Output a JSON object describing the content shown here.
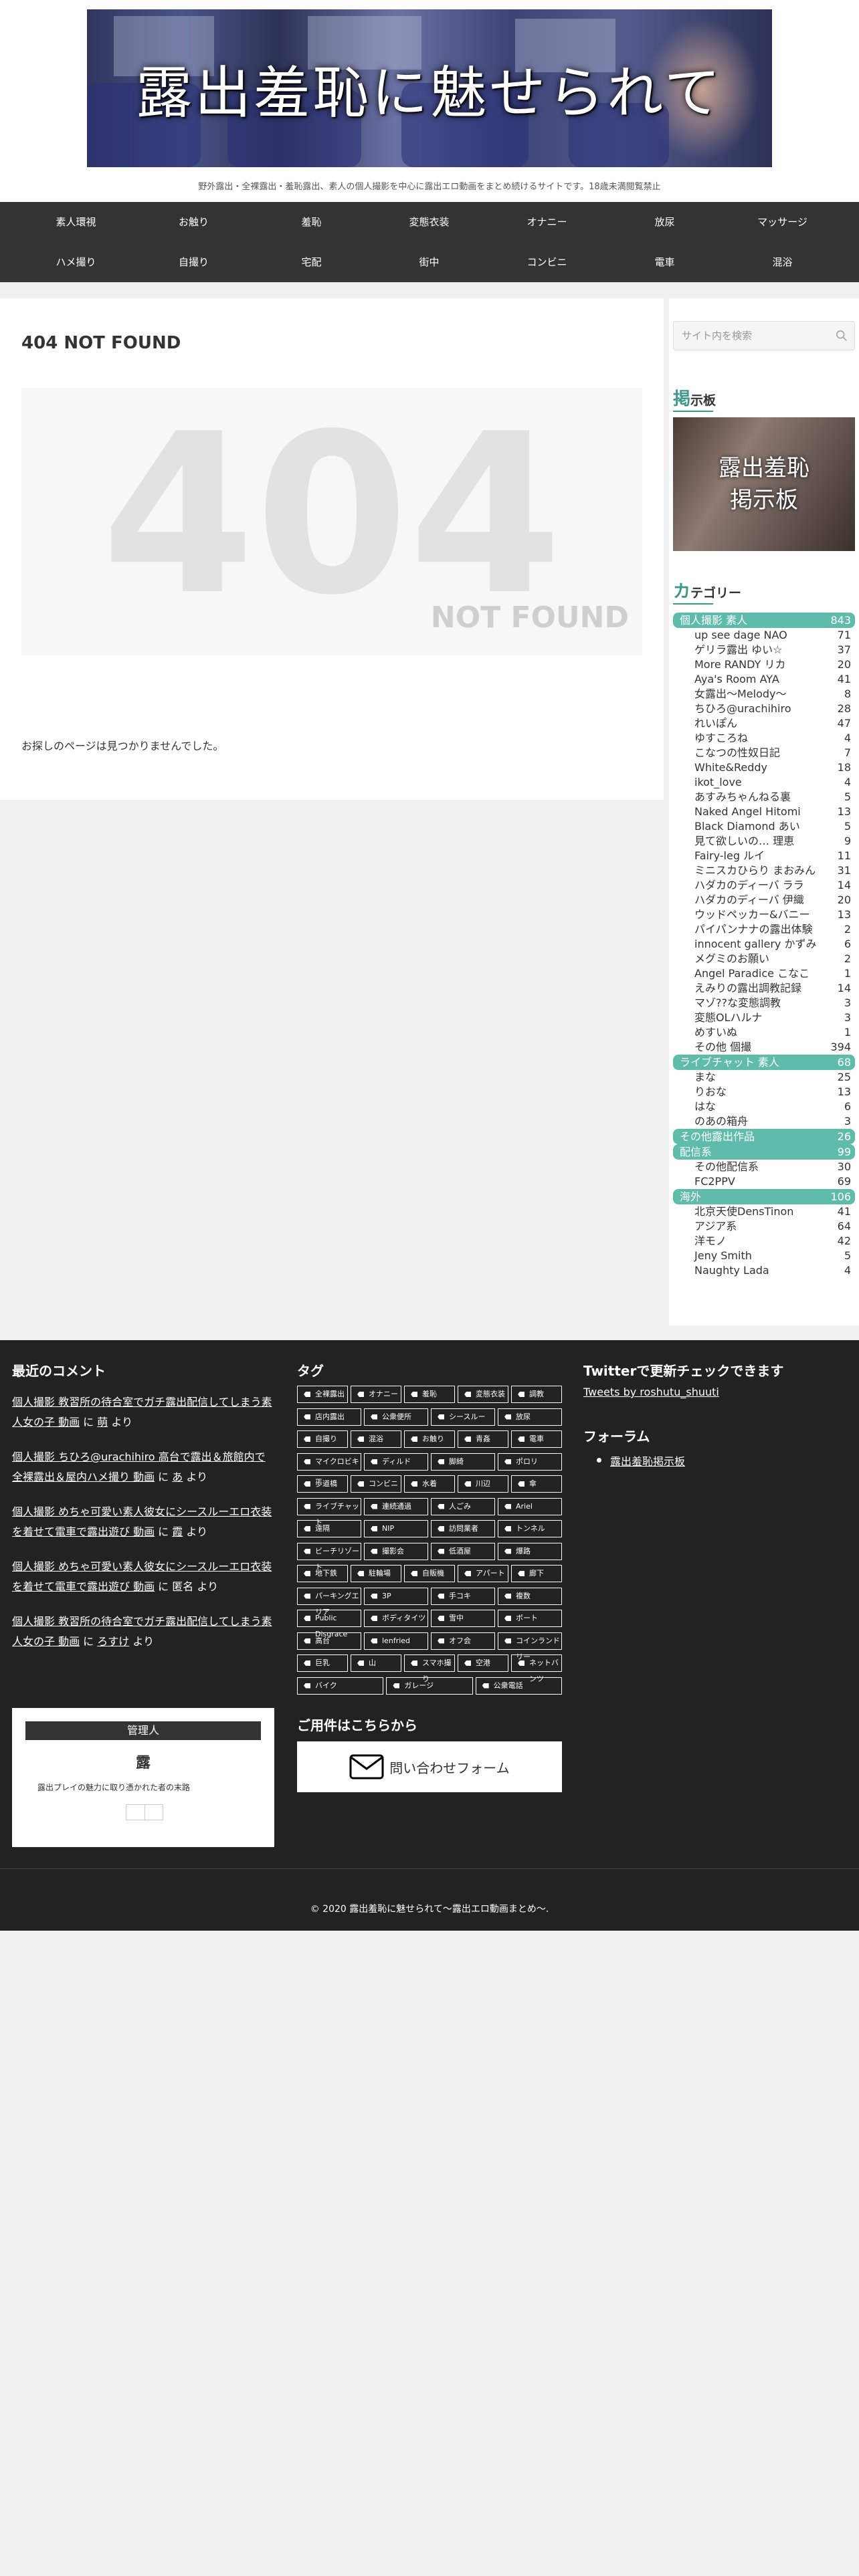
{
  "header": {
    "banner_title": "露出羞恥に魅せられて",
    "tagline": "野外露出・全裸露出・羞恥露出、素人の個人撮影を中心に露出エロ動画をまとめ続けるサイトです。18歳未満閲覧禁止"
  },
  "nav": {
    "row1": [
      "素人環視",
      "お触り",
      "羞恥",
      "変態衣装",
      "オナニー",
      "放尿",
      "マッサージ"
    ],
    "row2": [
      "ハメ撮り",
      "自撮り",
      "宅配",
      "街中",
      "コンビニ",
      "電車",
      "混浴"
    ]
  },
  "main": {
    "title": "404 NOT FOUND",
    "big_number": "404",
    "not_found": "NOT FOUND",
    "message": "お探しのページは見つかりませんでした。"
  },
  "sidebar": {
    "search_placeholder": "サイト内を検索",
    "bbs_title_first": "掲",
    "bbs_title_rest": "示板",
    "bbs_banner_line1": "露出羞恥",
    "bbs_banner_line2": "掲示板",
    "cat_title_first": "カ",
    "cat_title_rest": "テゴリー",
    "categories": [
      {
        "label": "個人撮影 素人",
        "count": "843",
        "parent": true
      },
      {
        "label": "up see dage NAO",
        "count": "71"
      },
      {
        "label": "ゲリラ露出 ゆい☆",
        "count": "37"
      },
      {
        "label": "More RANDY リカ",
        "count": "20"
      },
      {
        "label": "Aya's Room AYA",
        "count": "41"
      },
      {
        "label": "女露出〜Melody〜",
        "count": "8"
      },
      {
        "label": "ちひろ@urachihiro",
        "count": "28"
      },
      {
        "label": "れいぽん",
        "count": "47"
      },
      {
        "label": "ゆすころね",
        "count": "4"
      },
      {
        "label": "こなつの性奴日記",
        "count": "7"
      },
      {
        "label": "White&Reddy",
        "count": "18"
      },
      {
        "label": "ikot_love",
        "count": "4"
      },
      {
        "label": "あすみちゃんねる裏",
        "count": "5"
      },
      {
        "label": "Naked Angel Hitomi",
        "count": "13"
      },
      {
        "label": "Black Diamond あい",
        "count": "5"
      },
      {
        "label": "見て欲しいの… 理恵",
        "count": "9"
      },
      {
        "label": "Fairy-leg ルイ",
        "count": "11"
      },
      {
        "label": "ミニスカひらり まおみん",
        "count": "31"
      },
      {
        "label": "ハダカのディーバ ララ",
        "count": "14"
      },
      {
        "label": "ハダカのディーバ 伊織",
        "count": "20"
      },
      {
        "label": "ウッドペッカー&バニー",
        "count": "13"
      },
      {
        "label": "パイパンナナの露出体験",
        "count": "2"
      },
      {
        "label": "innocent gallery かずみ",
        "count": "6"
      },
      {
        "label": "メグミのお願い",
        "count": "2"
      },
      {
        "label": "Angel Paradice こなこ",
        "count": "1"
      },
      {
        "label": "えみりの露出調教記録",
        "count": "14"
      },
      {
        "label": "マゾ??な変態調教",
        "count": "3"
      },
      {
        "label": "変態OLハルナ",
        "count": "3"
      },
      {
        "label": "めすいぬ",
        "count": "1"
      },
      {
        "label": "その他 個撮",
        "count": "394"
      },
      {
        "label": "ライブチャット 素人",
        "count": "68",
        "parent": true
      },
      {
        "label": "まな",
        "count": "25"
      },
      {
        "label": "りおな",
        "count": "13"
      },
      {
        "label": "はな",
        "count": "6"
      },
      {
        "label": "のあの箱舟",
        "count": "3"
      },
      {
        "label": "その他露出作品",
        "count": "26",
        "parent": true
      },
      {
        "label": "配信系",
        "count": "99",
        "parent": true
      },
      {
        "label": "その他配信系",
        "count": "30"
      },
      {
        "label": "FC2PPV",
        "count": "69"
      },
      {
        "label": "海外",
        "count": "106",
        "parent": true
      },
      {
        "label": "北京天使DensTinon",
        "count": "41"
      },
      {
        "label": "アジア系",
        "count": "64"
      },
      {
        "label": "洋モノ",
        "count": "42"
      },
      {
        "label": "Jeny Smith",
        "count": "5"
      },
      {
        "label": "Naughty Lada",
        "count": "4"
      }
    ]
  },
  "footer": {
    "comments_title": "最近のコメント",
    "comments": [
      {
        "link": "個人撮影 教習所の待合室でガチ露出配信してしまう素人女の子 動画",
        "mid": " に ",
        "author": "萌",
        "tail": " より"
      },
      {
        "link": "個人撮影 ちひろ@urachihiro 高台で露出＆旅館内で全裸露出＆屋内ハメ撮り 動画",
        "mid": " に ",
        "author": "あ",
        "tail": " より"
      },
      {
        "link": "個人撮影 めちゃ可愛い素人彼女にシースルーエロ衣装を着せて電車で露出遊び 動画",
        "mid": " に ",
        "author": "霞",
        "tail": " より"
      },
      {
        "link": "個人撮影 めちゃ可愛い素人彼女にシースルーエロ衣装を着せて電車で露出遊び 動画",
        "mid": " に ",
        "author": "匿名",
        "tail": " より"
      },
      {
        "link": "個人撮影 教習所の待合室でガチ露出配信してしまう素人女の子 動画",
        "mid": " に ",
        "author": "ろすけ",
        "tail": " より"
      }
    ],
    "admin_title": "管理人",
    "admin_name": "露",
    "admin_desc": "露出プレイの魅力に取り憑かれた者の末路",
    "tags_title": "タグ",
    "tags": [
      [
        "全裸露出",
        "オナニー",
        "羞恥",
        "変態衣装",
        "調教"
      ],
      [
        "店内露出",
        "公衆便所",
        "シースルー",
        "放尿"
      ],
      [
        "自撮り",
        "混浴",
        "お触り",
        "青姦",
        "電車"
      ],
      [
        "マイクロビキニ",
        "ディルド",
        "脚綺",
        "ポロリ"
      ],
      [
        "歩道橋",
        "コンビニ",
        "水着",
        "川辺",
        "傘"
      ],
      [
        "ライブチャット",
        "連続通過",
        "人ごみ",
        "Ariel"
      ],
      [
        "遠隔",
        "NIP",
        "訪問業者",
        "トンネル"
      ],
      [
        "ビーチリゾート",
        "撮影会",
        "低酒屋",
        "爆路"
      ],
      [
        "地下鉄",
        "駐輪場",
        "自販機",
        "アパート",
        "廊下"
      ],
      [
        "パーキングエリア",
        "3P",
        "手コキ",
        "複数"
      ],
      [
        "Public Disgrace",
        "ボディタイツ",
        "雪中",
        "ボート"
      ],
      [
        "高台",
        "lenfried",
        "オフ会",
        "コインランドリー"
      ],
      [
        "巨乳",
        "山",
        "スマホ撮り",
        "空港",
        "ネットバンツ"
      ],
      [
        "バイク",
        "ガレージ",
        "公衆電話"
      ]
    ],
    "contact_title": "ご用件はこちらから",
    "contact_label": "問い合わせフォーム",
    "twitter_title": "Twitterで更新チェックできます",
    "twitter_link": "Tweets by roshutu_shuuti",
    "forum_title": "フォーラム",
    "forum_link": "露出羞恥掲示板",
    "copyright": "© 2020 露出羞恥に魅せられて〜露出エロ動画まとめ〜."
  }
}
